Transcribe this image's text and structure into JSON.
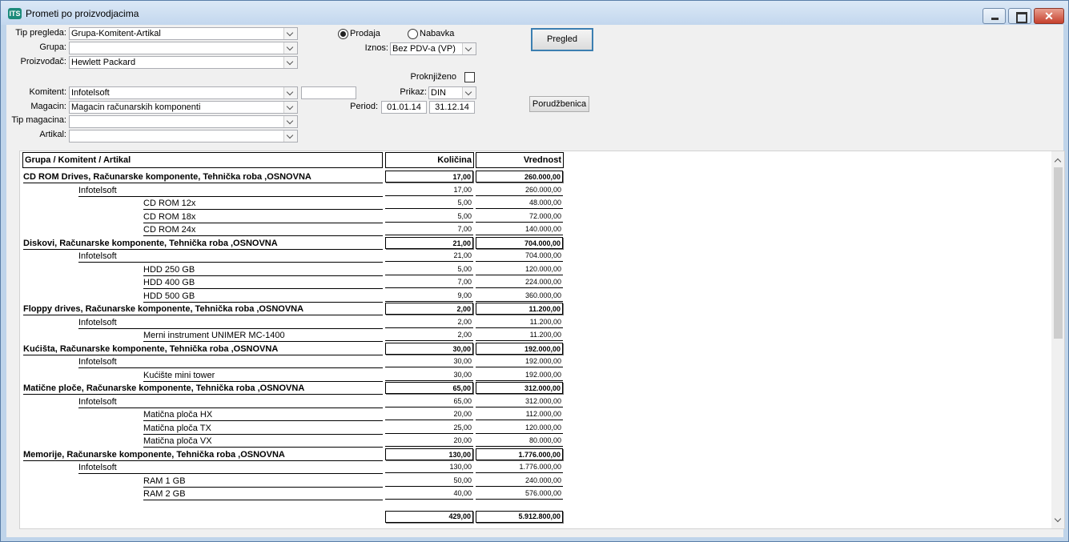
{
  "window": {
    "title": "Prometi po proizvodjacima",
    "icon": "app-icon",
    "close_glyph": "✕"
  },
  "filters": {
    "tip_pregleda": {
      "label": "Tip pregleda:",
      "value": "Grupa-Komitent-Artikal"
    },
    "grupa": {
      "label": "Grupa:",
      "value": ""
    },
    "proizvodjac": {
      "label": "Proizvođač:",
      "value": "Hewlett Packard"
    },
    "komitent": {
      "label": "Komitent:",
      "value": "Infotelsoft",
      "extra_value": ""
    },
    "magacin": {
      "label": "Magacin:",
      "value": "Magacin računarskih komponenti"
    },
    "tip_magacina": {
      "label": "Tip magacina:",
      "value": ""
    },
    "artikal": {
      "label": "Artikal:",
      "value": ""
    },
    "radio_prodaja": {
      "label": "Prodaja",
      "checked": true
    },
    "radio_nabavka": {
      "label": "Nabavka",
      "checked": false
    },
    "iznos": {
      "label": "Iznos:",
      "value": "Bez PDV-a (VP)"
    },
    "proknjizeno": {
      "label": "Proknjiženo",
      "checked": false
    },
    "prikaz": {
      "label": "Prikaz:",
      "value": "DIN"
    },
    "period": {
      "label": "Period:",
      "from": "01.01.14",
      "to": "31.12.14"
    }
  },
  "buttons": {
    "pregled": "Pregled",
    "porudzbenica": "Porudžbenica"
  },
  "report": {
    "headers": {
      "name": "Grupa / Komitent / Artikal",
      "qty": "Količina",
      "value": "Vrednost"
    },
    "rows": [
      {
        "level": "group",
        "name": "CD ROM Drives, Računarske komponente, Tehnička roba ,OSNOVNA",
        "qty": "17,00",
        "value": "260.000,00"
      },
      {
        "level": "client",
        "name": "Infotelsoft",
        "qty": "17,00",
        "value": "260.000,00"
      },
      {
        "level": "item",
        "name": "CD ROM 12x",
        "qty": "5,00",
        "value": "48.000,00"
      },
      {
        "level": "item",
        "name": "CD ROM 18x",
        "qty": "5,00",
        "value": "72.000,00"
      },
      {
        "level": "item",
        "name": "CD ROM 24x",
        "qty": "7,00",
        "value": "140.000,00"
      },
      {
        "level": "group",
        "name": "Diskovi, Računarske komponente, Tehnička roba ,OSNOVNA",
        "qty": "21,00",
        "value": "704.000,00"
      },
      {
        "level": "client",
        "name": "Infotelsoft",
        "qty": "21,00",
        "value": "704.000,00"
      },
      {
        "level": "item",
        "name": "HDD 250 GB",
        "qty": "5,00",
        "value": "120.000,00"
      },
      {
        "level": "item",
        "name": "HDD 400 GB",
        "qty": "7,00",
        "value": "224.000,00"
      },
      {
        "level": "item",
        "name": "HDD 500 GB",
        "qty": "9,00",
        "value": "360.000,00"
      },
      {
        "level": "group",
        "name": "Floppy drives, Računarske komponente, Tehnička roba ,OSNOVNA",
        "qty": "2,00",
        "value": "11.200,00"
      },
      {
        "level": "client",
        "name": "Infotelsoft",
        "qty": "2,00",
        "value": "11.200,00"
      },
      {
        "level": "item",
        "name": "Merni instrument UNIMER MC-1400",
        "qty": "2,00",
        "value": "11.200,00"
      },
      {
        "level": "group",
        "name": "Kućišta, Računarske komponente, Tehnička roba ,OSNOVNA",
        "qty": "30,00",
        "value": "192.000,00"
      },
      {
        "level": "client",
        "name": "Infotelsoft",
        "qty": "30,00",
        "value": "192.000,00"
      },
      {
        "level": "item",
        "name": "Kućište mini tower",
        "qty": "30,00",
        "value": "192.000,00"
      },
      {
        "level": "group",
        "name": "Matične ploče, Računarske komponente, Tehnička roba ,OSNOVNA",
        "qty": "65,00",
        "value": "312.000,00"
      },
      {
        "level": "client",
        "name": "Infotelsoft",
        "qty": "65,00",
        "value": "312.000,00"
      },
      {
        "level": "item",
        "name": "Matična ploča HX",
        "qty": "20,00",
        "value": "112.000,00"
      },
      {
        "level": "item",
        "name": "Matična ploča TX",
        "qty": "25,00",
        "value": "120.000,00"
      },
      {
        "level": "item",
        "name": "Matična ploča VX",
        "qty": "20,00",
        "value": "80.000,00"
      },
      {
        "level": "group",
        "name": "Memorije, Računarske komponente, Tehnička roba ,OSNOVNA",
        "qty": "130,00",
        "value": "1.776.000,00"
      },
      {
        "level": "client",
        "name": "Infotelsoft",
        "qty": "130,00",
        "value": "1.776.000,00"
      },
      {
        "level": "item",
        "name": "RAM 1 GB",
        "qty": "50,00",
        "value": "240.000,00"
      },
      {
        "level": "item",
        "name": "RAM 2 GB",
        "qty": "40,00",
        "value": "576.000,00"
      }
    ],
    "totals": {
      "qty": "429,00",
      "value": "5.912.800,00"
    }
  }
}
